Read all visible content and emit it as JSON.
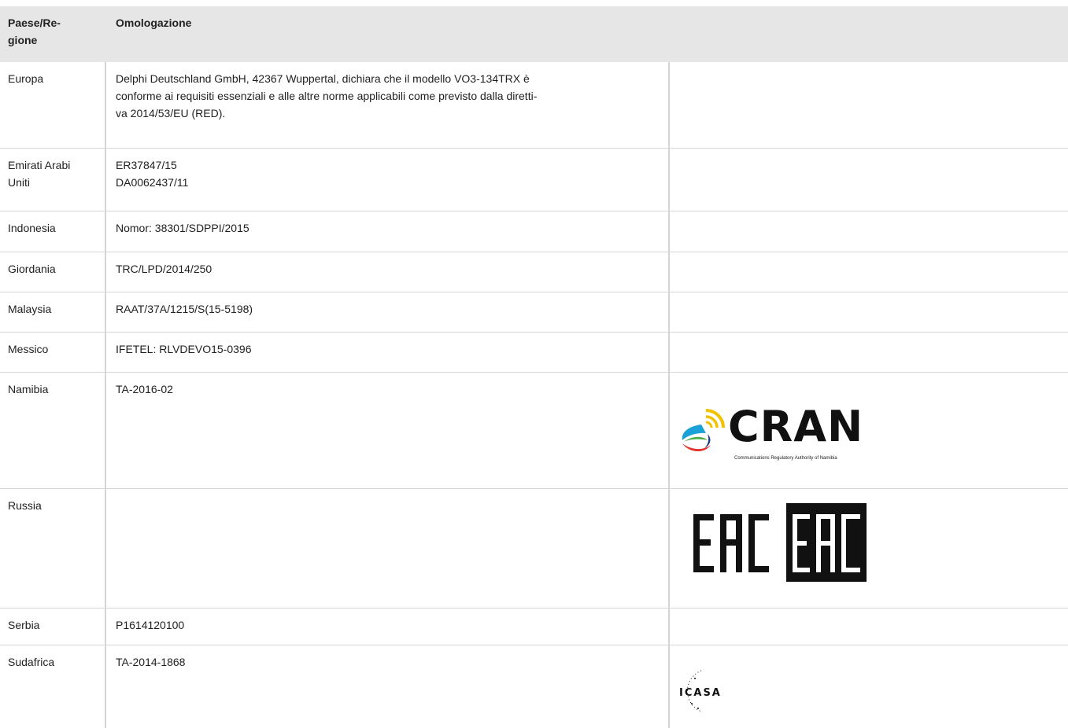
{
  "table": {
    "headers": {
      "country": "Paese/Re-\ngione",
      "approval": "Omologazione"
    },
    "rows": [
      {
        "country": "Europa",
        "approval": [
          "Delphi Deutschland GmbH, 42367 Wuppertal, dichiara che il modello VO3-134TRX è",
          "conforme ai requisiti essenziali e alle altre norme applicabili come previsto dalla diretti-",
          "va 2014/53/EU (RED)."
        ]
      },
      {
        "country": "Emirati Arabi\nUniti",
        "approval": [
          "ER37847/15",
          "DA0062437/11"
        ]
      },
      {
        "country": "Indonesia",
        "approval": [
          "Nomor: 38301/SDPPI/2015"
        ]
      },
      {
        "country": "Giordania",
        "approval": [
          "TRC/LPD/2014/250"
        ]
      },
      {
        "country": "Malaysia",
        "approval": [
          "RAAT/37A/1215/S(15-5198)"
        ]
      },
      {
        "country": "Messico",
        "approval": [
          "IFETEL: RLVDEVO15-0396"
        ]
      },
      {
        "country": "Namibia",
        "approval": [
          "TA-2016-02"
        ]
      },
      {
        "country": "Russia",
        "approval": []
      },
      {
        "country": "Serbia",
        "approval": [
          "P1614120100"
        ]
      },
      {
        "country": "Sudafrica",
        "approval": [
          "TA-2014-1868"
        ]
      }
    ]
  },
  "logos": {
    "cran": {
      "text": "CRAN",
      "subtitle": "Communications Regulatory Authority of Namibia",
      "icon": "cran-satellite-icon"
    },
    "eac": {
      "text": "EAC",
      "icon": "eac-mark-icon"
    },
    "icasa": {
      "text": "ICASA",
      "icon": "icasa-logo-icon"
    }
  }
}
